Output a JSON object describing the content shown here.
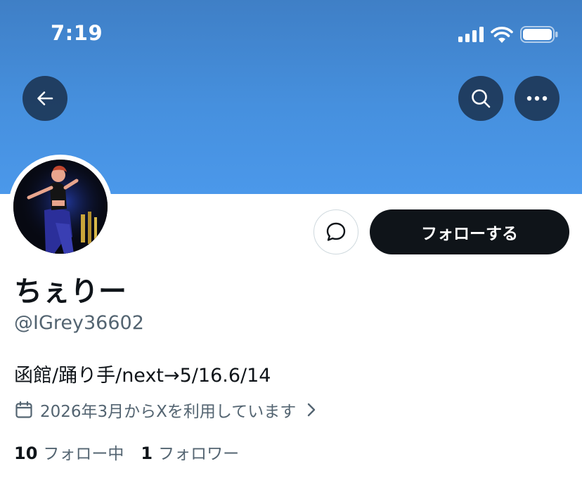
{
  "status_bar": {
    "time": "7:19",
    "icons": [
      "cellular-signal-icon",
      "wifi-icon",
      "battery-icon"
    ]
  },
  "header": {
    "banner_color": "#4690de",
    "buttons": [
      "back-arrow-icon",
      "search-icon",
      "more-icon"
    ]
  },
  "profile": {
    "avatar": "avatar-photo",
    "display_name": "ちぇりー",
    "handle": "@IGrey36602",
    "bio": "函館/踊り手/next→5/16.6/14",
    "joined": "2026年3月からXを利用しています",
    "follow_label": "フォローする",
    "message_icon": "message-bubble-icon"
  },
  "stats": {
    "following_count": "10",
    "following_label": "フォロー中",
    "followers_count": "1",
    "followers_label": "フォロワー"
  },
  "colors": {
    "accent_dark": "#0f1419",
    "secondary_text": "#536471"
  }
}
